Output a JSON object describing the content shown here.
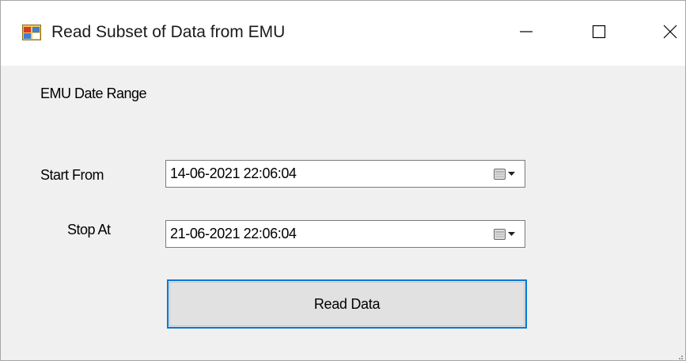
{
  "window": {
    "title": "Read Subset of Data from EMU",
    "app_icon": "windows-form-icon",
    "controls": {
      "minimize_icon": "minimize-icon",
      "maximize_icon": "maximize-icon",
      "close_icon": "close-icon"
    }
  },
  "form": {
    "range_label": "EMU Date Range",
    "start": {
      "label": "Start From",
      "value": "14-06-2021 22:06:04",
      "dropdown_icon": "calendar-dropdown-icon"
    },
    "stop": {
      "label": "Stop At",
      "value": "21-06-2021 22:06:04",
      "dropdown_icon": "calendar-dropdown-icon"
    },
    "read_button_label": "Read Data"
  },
  "colors": {
    "accent_focus_border": "#0078d7",
    "client_background": "#f0f0f0",
    "titlebar_background": "#ffffff"
  }
}
